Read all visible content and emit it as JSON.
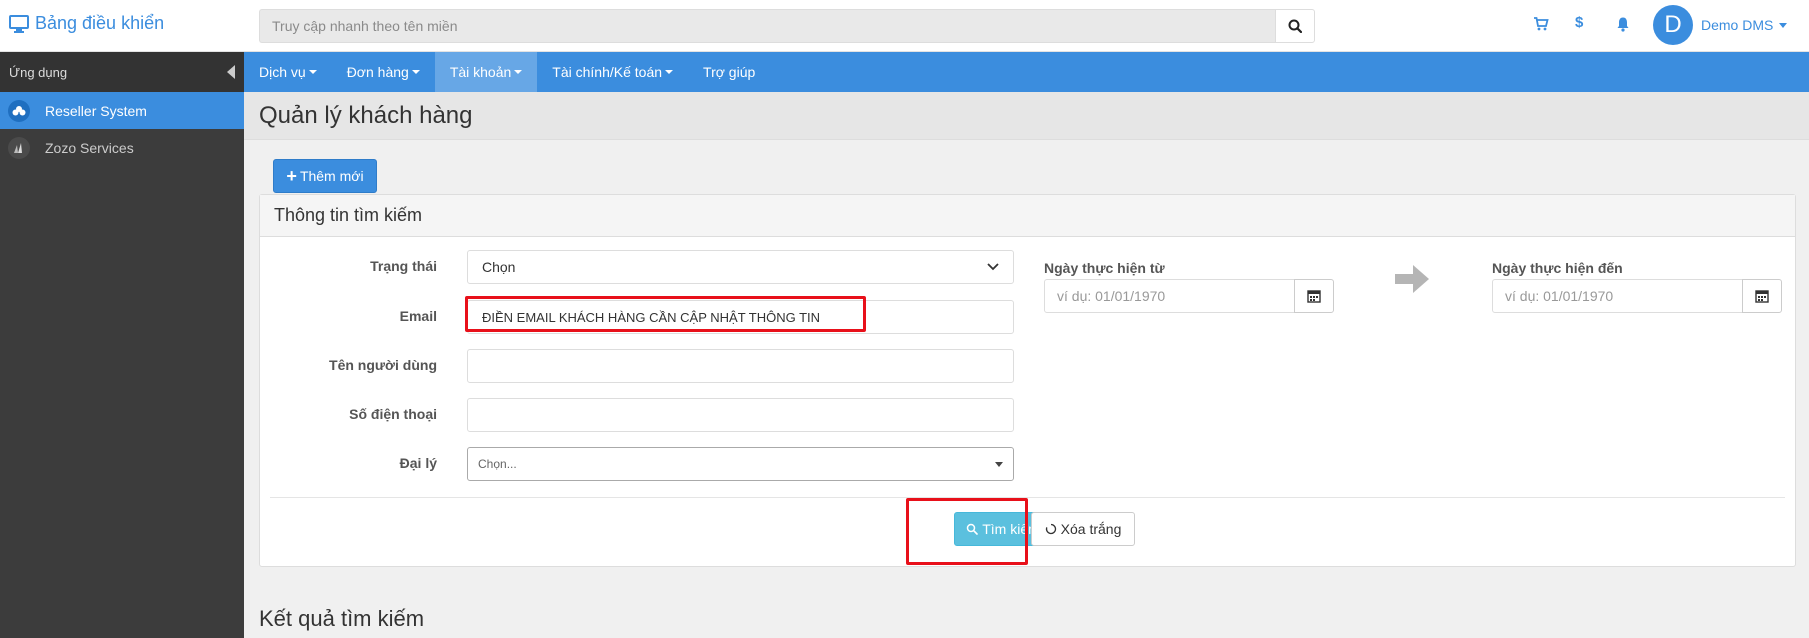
{
  "header": {
    "brand": "Bảng điều khiển",
    "search_placeholder": "Truy cập nhanh theo tên miền",
    "user_initial": "D",
    "user_name": "Demo DMS"
  },
  "sidebar": {
    "title": "Ứng dụng",
    "items": [
      {
        "label": "Reseller System",
        "active": true
      },
      {
        "label": "Zozo Services",
        "active": false
      }
    ]
  },
  "nav": {
    "items": [
      {
        "label": "Dịch vụ",
        "has_caret": true
      },
      {
        "label": "Đơn hàng",
        "has_caret": true
      },
      {
        "label": "Tài khoản",
        "has_caret": true,
        "active": true
      },
      {
        "label": "Tài chính/Kế toán",
        "has_caret": true
      },
      {
        "label": "Trợ giúp",
        "has_caret": false
      }
    ]
  },
  "page": {
    "title": "Quản lý khách hàng",
    "add_button": "Thêm mới"
  },
  "search_panel": {
    "heading": "Thông tin tìm kiếm",
    "status_label": "Trạng thái",
    "status_value": "Chọn",
    "email_label": "Email",
    "email_value": "ĐIỀN EMAIL KHÁCH HÀNG CẦN CẬP NHẬT THÔNG TIN",
    "username_label": "Tên người dùng",
    "username_value": "",
    "phone_label": "Số điện thoại",
    "phone_value": "",
    "agent_label": "Đại lý",
    "agent_value": "Chọn...",
    "date_from_label": "Ngày thực hiện từ",
    "date_from_placeholder": "ví dụ: 01/01/1970",
    "date_to_label": "Ngày thực hiện đến",
    "date_to_placeholder": "ví dụ: 01/01/1970",
    "search_button": "Tìm kiếm",
    "clear_button": "Xóa trắng"
  },
  "results": {
    "title": "Kết quả tìm kiếm"
  },
  "colors": {
    "primary": "#3b8dde",
    "info": "#5bc0de",
    "highlight": "#e8101a",
    "sidebar": "#3c3c3c"
  }
}
